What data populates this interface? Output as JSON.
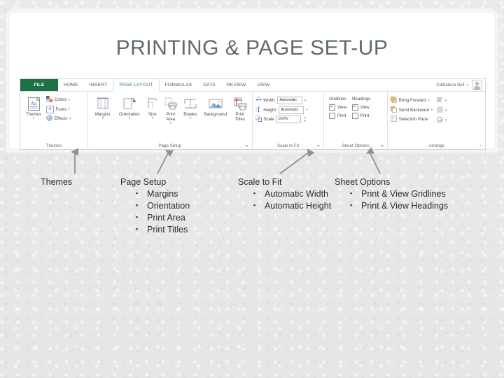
{
  "slide": {
    "title": "PRINTING & PAGE SET-UP",
    "title_color": "#5f6b6b",
    "background_color": "#e9e9e9"
  },
  "ribbon": {
    "app": "Excel",
    "accent_color": "#1e7145",
    "tabs": [
      {
        "label": "FILE",
        "active": false,
        "style": "file"
      },
      {
        "label": "HOME",
        "active": false
      },
      {
        "label": "INSERT",
        "active": false
      },
      {
        "label": "PAGE LAYOUT",
        "active": true
      },
      {
        "label": "FORMULAS",
        "active": false
      },
      {
        "label": "DATA",
        "active": false
      },
      {
        "label": "REVIEW",
        "active": false
      },
      {
        "label": "VIEW",
        "active": false
      }
    ],
    "account": {
      "name": "Cathalena Bell",
      "caret": "▾"
    },
    "groups": [
      {
        "label": "Themes",
        "big": [
          {
            "label": "Themes",
            "dropdown": "▾",
            "icon": "themes-icon"
          }
        ],
        "small": [
          {
            "label": "Colors",
            "icon": "colors-icon",
            "dropdown": "▾"
          },
          {
            "label": "Fonts",
            "icon": "fonts-icon",
            "dropdown": "▾"
          },
          {
            "label": "Effects",
            "icon": "effects-icon",
            "dropdown": "▾"
          }
        ]
      },
      {
        "label": "Page Setup",
        "dialog_launcher": "⬌",
        "big": [
          {
            "label": "Margins",
            "dropdown": "▾",
            "icon": "margins-icon"
          },
          {
            "label": "Orientation",
            "dropdown": "▾",
            "icon": "orientation-icon"
          },
          {
            "label": "Size",
            "dropdown": "▾",
            "icon": "size-icon"
          },
          {
            "label": "Print Area",
            "dropdown": "▾",
            "icon": "print-area-icon"
          },
          {
            "label": "Breaks",
            "dropdown": "▾",
            "icon": "breaks-icon"
          },
          {
            "label": "Background",
            "dropdown": "",
            "icon": "background-icon"
          },
          {
            "label": "Print Titles",
            "dropdown": "",
            "icon": "print-titles-icon"
          }
        ]
      },
      {
        "label": "Scale to Fit",
        "dialog_launcher": "⬌",
        "fields": [
          {
            "label": "Width:",
            "value": "Automatic",
            "control": "dropdown",
            "icon": "width-icon"
          },
          {
            "label": "Height:",
            "value": "Automatic",
            "control": "dropdown",
            "icon": "height-icon"
          },
          {
            "label": "Scale",
            "value": "100%",
            "control": "spinner",
            "icon": "scale-icon"
          }
        ]
      },
      {
        "label": "Sheet Options",
        "dialog_launcher": "⬌",
        "columns": [
          {
            "header": "Gridlines",
            "options": [
              {
                "label": "View",
                "checked": true
              },
              {
                "label": "Print",
                "checked": false
              }
            ]
          },
          {
            "header": "Headings",
            "options": [
              {
                "label": "View",
                "checked": true
              },
              {
                "label": "Print",
                "checked": false
              }
            ]
          }
        ]
      },
      {
        "label": "Arrange",
        "collapse": "˄",
        "small": [
          {
            "label": "Bring Forward",
            "icon": "bring-forward-icon",
            "dropdown": "▾"
          },
          {
            "label": "Send Backward",
            "icon": "send-backward-icon",
            "dropdown": "▾"
          },
          {
            "label": "Selection Pane",
            "icon": "selection-pane-icon",
            "dropdown": ""
          }
        ],
        "extra": [
          {
            "icon": "align-icon",
            "dropdown": "▾"
          },
          {
            "icon": "group-icon",
            "dropdown": "▾"
          },
          {
            "icon": "rotate-icon",
            "dropdown": "▾"
          }
        ]
      }
    ]
  },
  "callouts": [
    {
      "label": "Themes",
      "items": []
    },
    {
      "label": "Page Setup",
      "items": [
        "Margins",
        "Orientation",
        "Print Area",
        "Print Titles"
      ]
    },
    {
      "label": "Scale to Fit",
      "items": [
        "Automatic Width",
        "Automatic Height"
      ]
    },
    {
      "label": "Sheet Options",
      "items": [
        "Print & View Gridlines",
        "Print & View Headings"
      ]
    }
  ],
  "bullet_glyph": "▪",
  "arrow_color": "#8a9394"
}
